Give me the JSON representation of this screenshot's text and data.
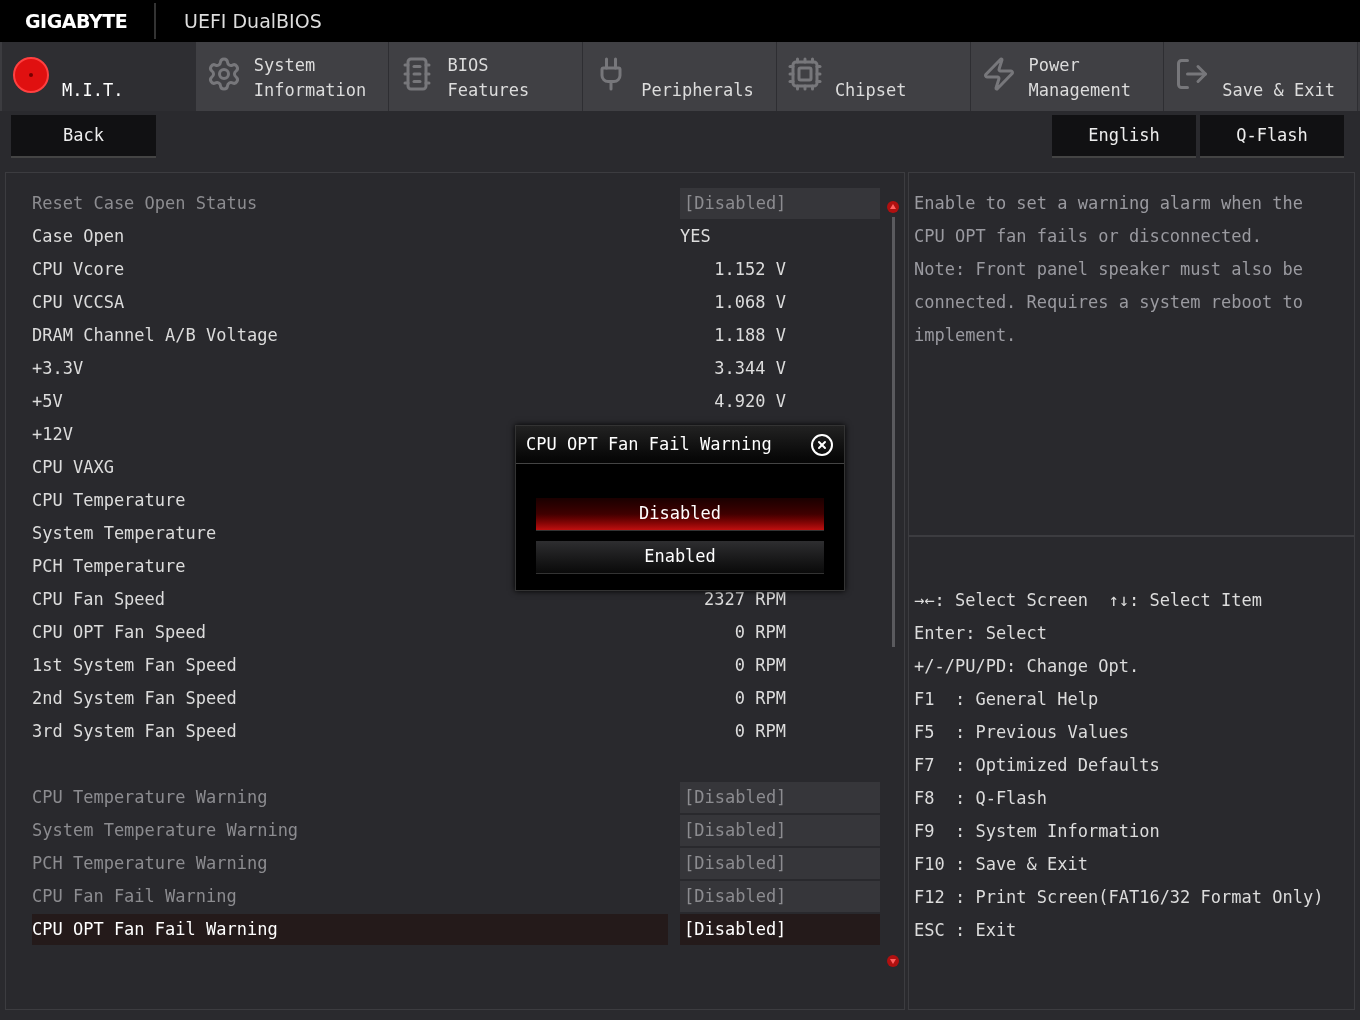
{
  "header": {
    "brand": "GIGABYTE",
    "product": "UEFI DualBIOS"
  },
  "tabs": [
    {
      "kind": "mit",
      "lines": [
        "M.I.T."
      ],
      "selected": true
    },
    {
      "kind": "gear",
      "lines": [
        "System",
        "Information"
      ],
      "selected": false
    },
    {
      "kind": "chip-plus",
      "lines": [
        "BIOS",
        "Features"
      ],
      "selected": false
    },
    {
      "kind": "plug",
      "lines": [
        "Peripherals"
      ],
      "selected": false
    },
    {
      "kind": "chip",
      "lines": [
        "Chipset"
      ],
      "selected": false
    },
    {
      "kind": "power",
      "lines": [
        "Power",
        "Management"
      ],
      "selected": false
    },
    {
      "kind": "exit",
      "lines": [
        "Save & Exit"
      ],
      "selected": false
    }
  ],
  "left_buttons": [
    "Back"
  ],
  "right_buttons": [
    "English",
    "Q-Flash"
  ],
  "settings": [
    [
      {
        "label": "Reset Case Open Status",
        "kind": "option",
        "value": "[Disabled]",
        "disabled": true,
        "selected": false
      },
      {
        "label": "Case Open",
        "kind": "status",
        "value": "YES",
        "disabled": false,
        "selected": false
      },
      {
        "label": "CPU Vcore",
        "kind": "reading",
        "value": "1.152 V",
        "disabled": false,
        "selected": false
      },
      {
        "label": "CPU VCCSA",
        "kind": "reading",
        "value": "1.068 V",
        "disabled": false,
        "selected": false
      },
      {
        "label": "DRAM Channel A/B Voltage",
        "kind": "reading",
        "value": "1.188 V",
        "disabled": false,
        "selected": false
      },
      {
        "label": "+3.3V",
        "kind": "reading",
        "value": "3.344 V",
        "disabled": false,
        "selected": false
      },
      {
        "label": "+5V",
        "kind": "reading",
        "value": "4.920 V",
        "disabled": false,
        "selected": false
      },
      {
        "label": "+12V",
        "kind": "reading",
        "disabled": false,
        "selected": false
      },
      {
        "label": "CPU VAXG",
        "kind": "reading",
        "disabled": false,
        "selected": false
      },
      {
        "label": "CPU Temperature",
        "kind": "reading",
        "disabled": false,
        "selected": false
      },
      {
        "label": "System Temperature",
        "kind": "reading",
        "disabled": false,
        "selected": false
      },
      {
        "label": "PCH Temperature",
        "kind": "reading",
        "disabled": false,
        "selected": false
      },
      {
        "label": "CPU Fan Speed",
        "kind": "reading",
        "value": "2327 RPM",
        "disabled": false,
        "selected": false
      },
      {
        "label": "CPU OPT Fan Speed",
        "kind": "reading",
        "value": "0 RPM",
        "disabled": false,
        "selected": false
      },
      {
        "label": "1st System Fan Speed",
        "kind": "reading",
        "value": "0 RPM",
        "disabled": false,
        "selected": false
      },
      {
        "label": "2nd System Fan Speed",
        "kind": "reading",
        "value": "0 RPM",
        "disabled": false,
        "selected": false
      },
      {
        "label": "3rd System Fan Speed",
        "kind": "reading",
        "value": "0 RPM",
        "disabled": false,
        "selected": false
      }
    ],
    [
      {
        "label": "CPU Temperature Warning",
        "kind": "option",
        "value": "[Disabled]",
        "disabled": true,
        "selected": false
      },
      {
        "label": "System Temperature Warning",
        "kind": "option",
        "value": "[Disabled]",
        "disabled": true,
        "selected": false
      },
      {
        "label": "PCH Temperature Warning",
        "kind": "option",
        "value": "[Disabled]",
        "disabled": true,
        "selected": false
      },
      {
        "label": "CPU Fan Fail Warning",
        "kind": "option",
        "value": "[Disabled]",
        "disabled": true,
        "selected": false
      },
      {
        "label": "CPU OPT Fan Fail Warning",
        "kind": "option",
        "value": "[Disabled]",
        "disabled": false,
        "selected": true
      }
    ]
  ],
  "popup": {
    "title": "CPU OPT Fan Fail Warning",
    "options": [
      {
        "label": "Disabled",
        "selected": true
      },
      {
        "label": "Enabled",
        "selected": false
      }
    ]
  },
  "help": {
    "paragraphs": [
      "Enable to set a warning alarm when the CPU OPT fan fails or disconnected.",
      "Note: Front panel speaker must also be connected. Requires a system reboot to implement."
    ],
    "keys": [
      "→←: Select Screen  ↑↓: Select Item",
      "Enter: Select",
      "+/-/PU/PD: Change Opt.",
      "F1  : General Help",
      "F5  : Previous Values",
      "F7  : Optimized Defaults",
      "F8  : Q-Flash",
      "F9  : System Information",
      "F10 : Save & Exit",
      "F12 : Print Screen(FAT16/32 Format Only)",
      "ESC : Exit"
    ]
  }
}
